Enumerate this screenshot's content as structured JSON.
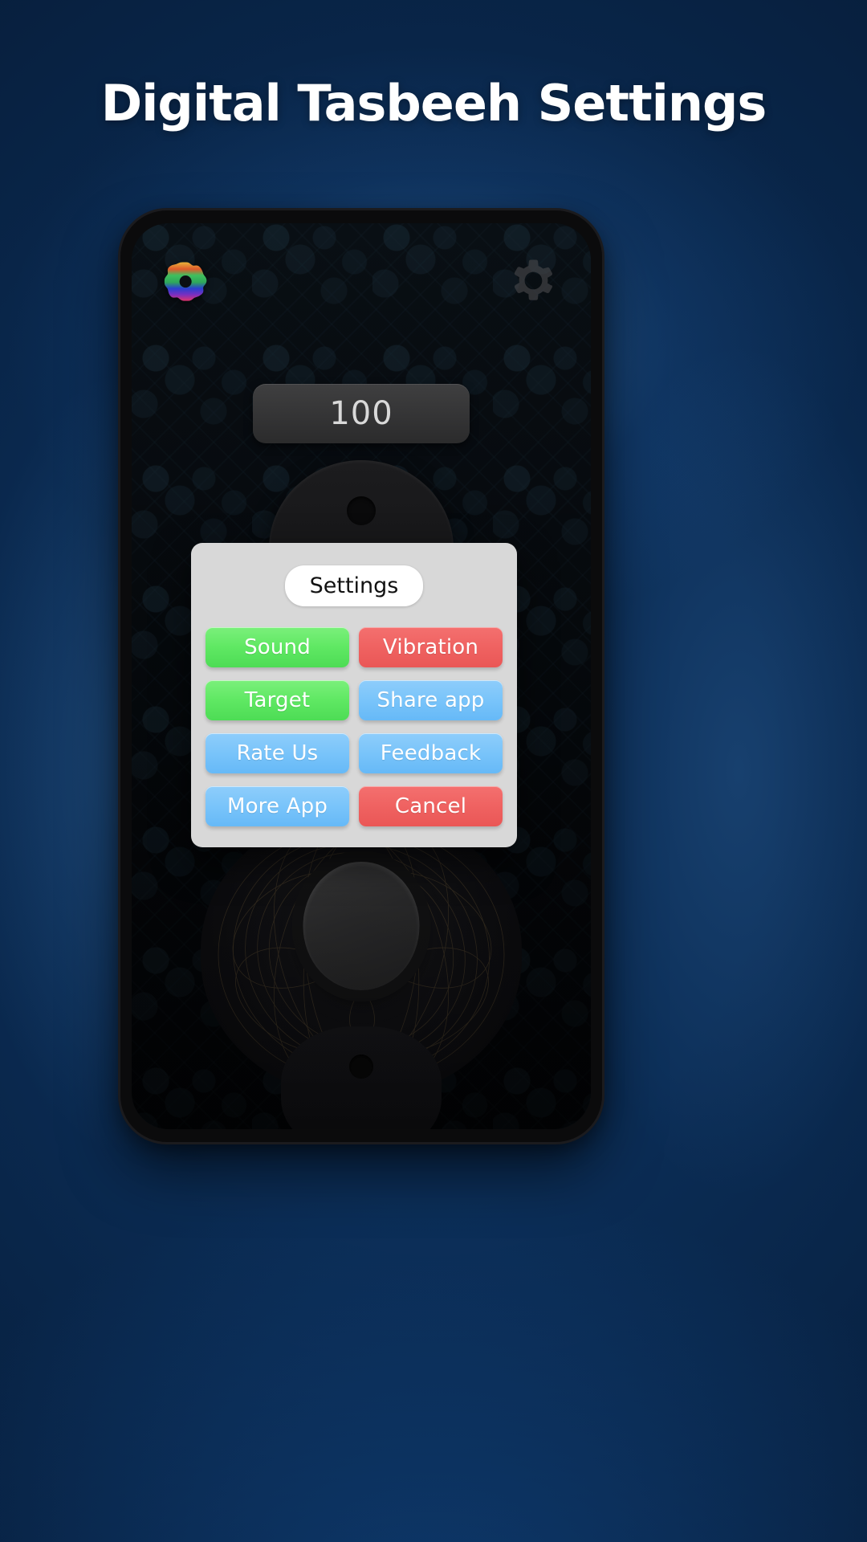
{
  "page": {
    "headline": "Digital Tasbeeh Settings",
    "background_top_color": "#2a6ba8",
    "background_bottom_color": "#071d3d"
  },
  "phone": {
    "status": {
      "flower_icon": "rainbow-flower-icon",
      "gear_icon": "gear-icon"
    },
    "counter": {
      "value": "100"
    }
  },
  "dialog": {
    "title": "Settings",
    "title_bg": "#ffffff",
    "panel_bg": "#d8d8d8",
    "colors": {
      "green": "#5fe863",
      "blue": "#79c4fa",
      "red": "#ef6261"
    },
    "buttons": [
      {
        "label": "Sound",
        "color": "green",
        "name": "sound-button"
      },
      {
        "label": "Vibration",
        "color": "red",
        "name": "vibration-button"
      },
      {
        "label": "Target",
        "color": "green",
        "name": "target-button"
      },
      {
        "label": "Share app",
        "color": "blue",
        "name": "share-app-button"
      },
      {
        "label": "Rate Us",
        "color": "blue",
        "name": "rate-us-button"
      },
      {
        "label": "Feedback",
        "color": "blue",
        "name": "feedback-button"
      },
      {
        "label": "More App",
        "color": "blue",
        "name": "more-app-button"
      },
      {
        "label": "Cancel",
        "color": "red",
        "name": "cancel-button"
      }
    ]
  }
}
